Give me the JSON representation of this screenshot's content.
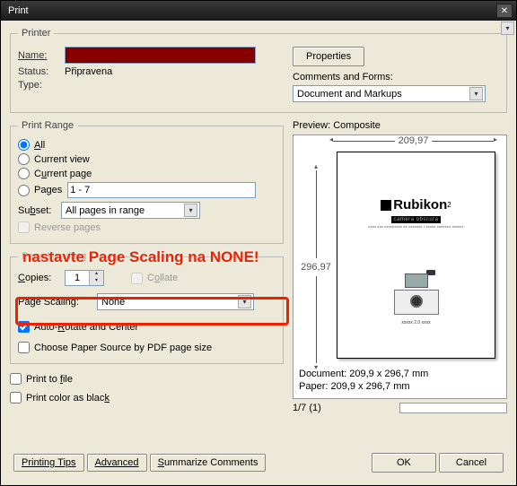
{
  "title": "Print",
  "printer": {
    "legend": "Printer",
    "name_label": "Name:",
    "status_label": "Status:",
    "status_value": "Připravena",
    "type_label": "Type:",
    "properties_btn": "Properties",
    "comments_label": "Comments and Forms:",
    "comments_value": "Document and Markups"
  },
  "range": {
    "legend": "Print Range",
    "all": "All",
    "current_view": "Current view",
    "current_page": "Current page",
    "pages": "Pages",
    "pages_value": "1 - 7",
    "subset_label": "Subset:",
    "subset_value": "All pages in range",
    "reverse": "Reverse pages"
  },
  "handling": {
    "legend": "Page Handling",
    "copies": "Copies:",
    "copies_value": "1",
    "collate": "Collate",
    "page_scaling": "Page Scaling:",
    "page_scaling_value": "None",
    "auto_rotate": "Auto-Rotate and Center",
    "paper_source": "Choose Paper Source by PDF page size"
  },
  "print_to_file": "Print to file",
  "print_black": "Print color as black",
  "preview": {
    "label": "Preview: Composite",
    "width": "209,97",
    "height": "296,97",
    "brand_name": "Rubikon",
    "brand_sup": "2",
    "brand_sub": "camera obscura",
    "brand_small": "xxxx xxx xxxxxxxxx xx xxxxxxx / xxxxx xxxxxxx xxxxxx",
    "cam_label": "xxxxx 2.0 xxxx",
    "doc": "Document: 209,9 x 296,7 mm",
    "paper": "Paper: 209,9 x 296,7 mm",
    "pages": "1/7 (1)"
  },
  "buttons": {
    "tips": "Printing Tips",
    "advanced": "Advanced",
    "summarize": "Summarize Comments",
    "ok": "OK",
    "cancel": "Cancel"
  },
  "overlay": "nastavte Page Scaling na NONE!"
}
